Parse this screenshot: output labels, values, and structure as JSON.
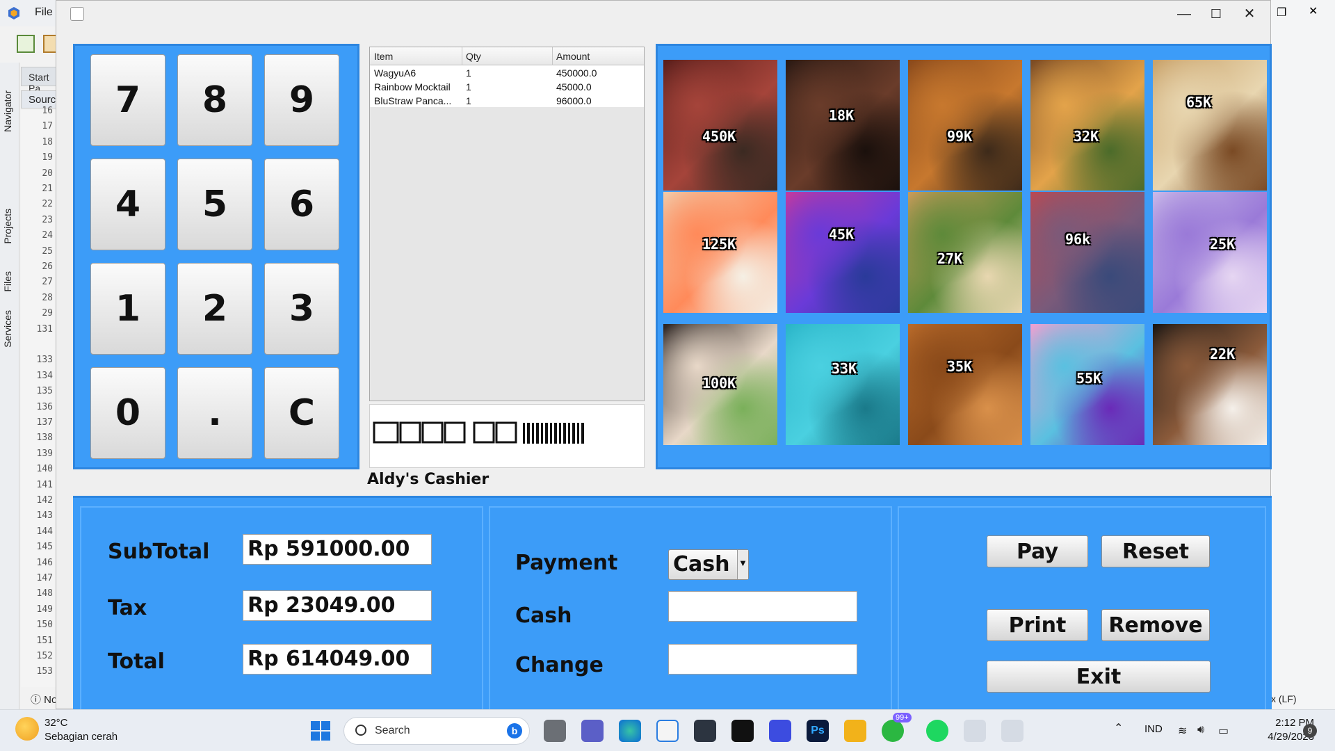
{
  "ide": {
    "menu_file": "File",
    "tab_start": "Start Pa",
    "source_tab": "Source",
    "side_tabs": [
      "Navigator",
      "Projects",
      "Files",
      "Services"
    ],
    "line_numbers": [
      "16",
      "17",
      "18",
      "19",
      "20",
      "21",
      "22",
      "23",
      "24",
      "25",
      "26",
      "27",
      "28",
      "29",
      "131",
      "",
      "133",
      "134",
      "135",
      "136",
      "137",
      "138",
      "139",
      "140",
      "141",
      "142",
      "143",
      "144",
      "145",
      "146",
      "147",
      "148",
      "149",
      "150",
      "151",
      "152",
      "153"
    ],
    "bottom_label": "No",
    "status_right": "x (LF)"
  },
  "app": {
    "window_controls": {
      "minimize": "—",
      "maximize": "☐",
      "close": "✕"
    },
    "keypad": [
      "7",
      "8",
      "9",
      "4",
      "5",
      "6",
      "1",
      "2",
      "3",
      "0",
      ".",
      "C"
    ],
    "order_table": {
      "columns": [
        "Item",
        "Qty",
        "Amount"
      ],
      "rows": [
        {
          "item": "WagyuA6",
          "qty": "1",
          "amount": "450000.0"
        },
        {
          "item": "Rainbow Mocktail",
          "qty": "1",
          "amount": "45000.0"
        },
        {
          "item": "BluStraw Panca...",
          "qty": "1",
          "amount": "96000.0"
        }
      ]
    },
    "cashier_name": "Aldy's Cashier",
    "menu_items": [
      {
        "price": "450K",
        "palette": [
          "#5a1f1c",
          "#a5443a",
          "#3b2a22"
        ]
      },
      {
        "price": "18K",
        "palette": [
          "#2b1a14",
          "#6a3c2a",
          "#1a100c"
        ]
      },
      {
        "price": "99K",
        "palette": [
          "#8a4a1c",
          "#c7782e",
          "#3d2a1a"
        ]
      },
      {
        "price": "32K",
        "palette": [
          "#7a4a24",
          "#e3a34a",
          "#4b6b2a"
        ]
      },
      {
        "price": "65K",
        "palette": [
          "#c9a26a",
          "#e8d6b0",
          "#7a4a24"
        ]
      },
      {
        "price": "125K",
        "palette": [
          "#f2c9a8",
          "#ff8a5a",
          "#f5f0e5"
        ]
      },
      {
        "price": "45K",
        "palette": [
          "#c23a9e",
          "#6a3ad8",
          "#2a3a9a"
        ]
      },
      {
        "price": "27K",
        "palette": [
          "#c79a5a",
          "#5e8a3a",
          "#e8d7b0"
        ]
      },
      {
        "price": "96k",
        "palette": [
          "#b84a54",
          "#7a5a7a",
          "#3a4a7a"
        ]
      },
      {
        "price": "25K",
        "palette": [
          "#c8b8e8",
          "#9a7ad8",
          "#e6d6f2"
        ]
      },
      {
        "price": "100K",
        "palette": [
          "#2a2220",
          "#e8d8c8",
          "#7ab05a"
        ]
      },
      {
        "price": "33K",
        "palette": [
          "#2ab5c8",
          "#4ad0e0",
          "#1a7a8a"
        ]
      },
      {
        "price": "35K",
        "palette": [
          "#b86a2a",
          "#8a4a1a",
          "#d9904a"
        ]
      },
      {
        "price": "55K",
        "palette": [
          "#f0a0d0",
          "#5ac0e0",
          "#6a2ab8"
        ]
      },
      {
        "price": "22K",
        "palette": [
          "#1a1614",
          "#8a5a3a",
          "#f5f0ea"
        ]
      }
    ],
    "totals": {
      "subtotal_label": "SubTotal",
      "subtotal_value": "Rp 591000.00",
      "tax_label": "Tax",
      "tax_value": "Rp 23049.00",
      "total_label": "Total",
      "total_value": "Rp 614049.00"
    },
    "payment": {
      "payment_label": "Payment",
      "payment_method": "Cash",
      "cash_label": "Cash",
      "cash_value": "",
      "change_label": "Change",
      "change_value": ""
    },
    "actions": {
      "pay": "Pay",
      "reset": "Reset",
      "print": "Print",
      "remove": "Remove",
      "exit": "Exit"
    }
  },
  "taskbar": {
    "weather_temp": "32°C",
    "weather_desc": "Sebagian cerah",
    "search_placeholder": "Search",
    "whatsapp_badge": "99+",
    "lang": "IND",
    "time": "2:12 PM",
    "date": "4/29/2023",
    "notifications": "9"
  },
  "colors": {
    "accent_blue": "#3c9cf8",
    "panel_border": "#2d86e0"
  }
}
